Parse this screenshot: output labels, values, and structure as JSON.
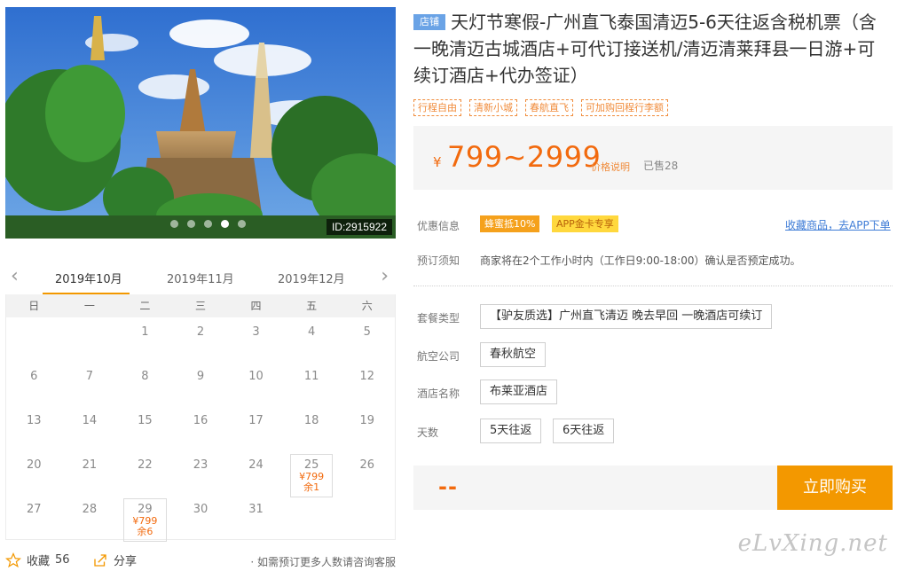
{
  "photo": {
    "id_label": "ID:2915922",
    "slides": 5,
    "active_slide": 4
  },
  "calendar": {
    "months": [
      "2019年10月",
      "2019年11月",
      "2019年12月"
    ],
    "active_month": 0,
    "prev_icon": "chevron-left-icon",
    "next_icon": "chevron-right-icon",
    "weekdays": [
      "日",
      "一",
      "二",
      "三",
      "四",
      "五",
      "六"
    ],
    "leading_blanks": 2,
    "days": [
      {
        "d": "1"
      },
      {
        "d": "2"
      },
      {
        "d": "3"
      },
      {
        "d": "4"
      },
      {
        "d": "5"
      },
      {
        "d": "6"
      },
      {
        "d": "7"
      },
      {
        "d": "8"
      },
      {
        "d": "9"
      },
      {
        "d": "10"
      },
      {
        "d": "11"
      },
      {
        "d": "12"
      },
      {
        "d": "13"
      },
      {
        "d": "14"
      },
      {
        "d": "15"
      },
      {
        "d": "16"
      },
      {
        "d": "17"
      },
      {
        "d": "18"
      },
      {
        "d": "19"
      },
      {
        "d": "20"
      },
      {
        "d": "21"
      },
      {
        "d": "22"
      },
      {
        "d": "23"
      },
      {
        "d": "24"
      },
      {
        "d": "25",
        "price": "¥799",
        "stock": "余1"
      },
      {
        "d": "26"
      },
      {
        "d": "27"
      },
      {
        "d": "28"
      },
      {
        "d": "29",
        "price": "¥799",
        "stock": "余6"
      },
      {
        "d": "30"
      },
      {
        "d": "31"
      }
    ]
  },
  "actions": {
    "fav_label": "收藏",
    "fav_count": "56",
    "share_label": "分享",
    "note": "· 如需预订更多人数请咨询客服"
  },
  "product": {
    "shop_tag": "店铺",
    "title": "天灯节寒假-广州直飞泰国清迈5-6天往返含税机票（含一晚清迈古城酒店+可代订接送机/清迈清莱拜县一日游+可续订酒店+代办签证）",
    "tags": [
      "行程自由",
      "清新小城",
      "春航直飞",
      "可加购回程行李额"
    ]
  },
  "price": {
    "currency": "¥",
    "range": "799~2999",
    "explain": "价格说明",
    "sold": "已售28"
  },
  "promo": {
    "label": "优惠信息",
    "coupon1": "蜂蜜抵10%",
    "coupon2": "APP金卡专享",
    "app_link": "收藏商品，去APP下单"
  },
  "booking_notice": {
    "label": "预订须知",
    "text": "商家将在2个工作小时内（工作日9:00-18:00）确认是否预定成功。"
  },
  "options": {
    "package_label": "套餐类型",
    "package_value": "【驴友质选】广州直飞清迈 晚去早回 一晚酒店可续订",
    "airline_label": "航空公司",
    "airline_value": "春秋航空",
    "hotel_label": "酒店名称",
    "hotel_value": "布莱亚酒店",
    "days_label": "天数",
    "days_values": [
      "5天往返",
      "6天往返"
    ]
  },
  "buy": {
    "total": "--",
    "button": "立即购买"
  },
  "watermark": "eLvXing.net",
  "colors": {
    "accent": "#f39800",
    "price": "#f26a0e",
    "shop_tag": "#6aa3e6",
    "link": "#3d7bd6"
  }
}
